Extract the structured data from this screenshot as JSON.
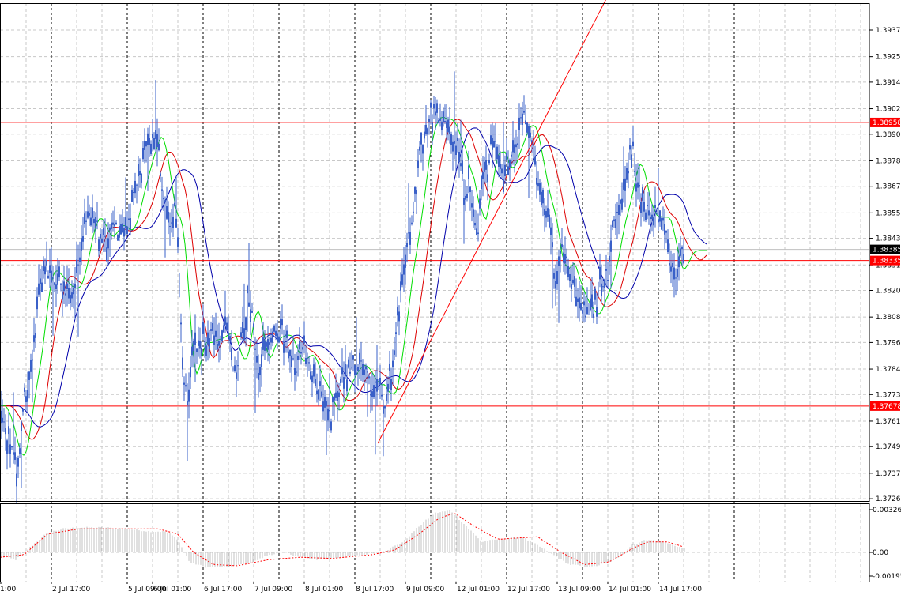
{
  "chart_data": [
    {
      "type": "candlestick",
      "grid": true,
      "price_axis_ticks": [
        "1.39375",
        "1.39255",
        "1.39140",
        "1.39020",
        "1.38905",
        "1.38785",
        "1.38670",
        "1.38550",
        "1.38435",
        "1.38315",
        "1.38200",
        "1.38080",
        "1.37965",
        "1.37845",
        "1.37730",
        "1.37610",
        "1.37495",
        "1.37375",
        "1.37260"
      ],
      "time_axis_labels": [
        "1:00",
        "2 Jul 17:00",
        "5 Jul 09:00",
        "6 Jul 01:00",
        "6 Jul 17:00",
        "7 Jul 09:00",
        "8 Jul 01:00",
        "8 Jul 17:00",
        "9 Jul 09:00",
        "12 Jul 01:00",
        "12 Jul 17:00",
        "13 Jul 09:00",
        "14 Jul 01:00",
        "14 Jul 17:00"
      ],
      "ylim": [
        1.3726,
        1.39505
      ],
      "horizontal_levels": [
        {
          "value": 1.38958,
          "label": "1.38958",
          "color": "#ff0000"
        },
        {
          "value": 1.38335,
          "label": "1.38335",
          "color": "#ff0000"
        },
        {
          "value": 1.37678,
          "label": "1.37678",
          "color": "#ff0000"
        }
      ],
      "current_price": {
        "value": 1.38385,
        "label": "1.38385"
      },
      "trendline": {
        "from_value": 1.3751,
        "to_value": 1.3955,
        "color": "#ff0000"
      },
      "series": [
        {
          "color": "#00dd00",
          "role": "fast-ma"
        },
        {
          "color": "#dd0000",
          "role": "medium-ma"
        },
        {
          "color": "#0000aa",
          "role": "slow-ma"
        }
      ],
      "close_path": [
        [
          0,
          1.3768
        ],
        [
          7,
          1.3756
        ],
        [
          14,
          1.3748
        ],
        [
          20,
          1.3738
        ],
        [
          26,
          1.3755
        ],
        [
          32,
          1.3775
        ],
        [
          38,
          1.3782
        ],
        [
          44,
          1.3796
        ],
        [
          50,
          1.3822
        ],
        [
          56,
          1.3832
        ],
        [
          62,
          1.3828
        ],
        [
          70,
          1.3826
        ],
        [
          78,
          1.3822
        ],
        [
          86,
          1.382
        ],
        [
          94,
          1.3822
        ],
        [
          102,
          1.3838
        ],
        [
          110,
          1.3852
        ],
        [
          118,
          1.3855
        ],
        [
          126,
          1.3845
        ],
        [
          134,
          1.3842
        ],
        [
          142,
          1.3852
        ],
        [
          150,
          1.3848
        ],
        [
          158,
          1.3845
        ],
        [
          166,
          1.3856
        ],
        [
          174,
          1.387
        ],
        [
          182,
          1.3878
        ],
        [
          188,
          1.3888
        ],
        [
          194,
          1.3892
        ],
        [
          198,
          1.389
        ],
        [
          204,
          1.387
        ],
        [
          210,
          1.3856
        ],
        [
          216,
          1.3848
        ],
        [
          222,
          1.3856
        ],
        [
          226,
          1.383
        ],
        [
          232,
          1.3778
        ],
        [
          238,
          1.3772
        ],
        [
          244,
          1.38
        ],
        [
          252,
          1.3795
        ],
        [
          262,
          1.3798
        ],
        [
          272,
          1.3798
        ],
        [
          282,
          1.3802
        ],
        [
          290,
          1.38
        ],
        [
          298,
          1.378
        ],
        [
          306,
          1.3798
        ],
        [
          314,
          1.3818
        ],
        [
          320,
          1.381
        ],
        [
          326,
          1.3782
        ],
        [
          332,
          1.379
        ],
        [
          340,
          1.38
        ],
        [
          348,
          1.3798
        ],
        [
          356,
          1.3802
        ],
        [
          362,
          1.3798
        ],
        [
          368,
          1.3788
        ],
        [
          376,
          1.3786
        ],
        [
          384,
          1.3795
        ],
        [
          392,
          1.3785
        ],
        [
          400,
          1.3778
        ],
        [
          408,
          1.3775
        ],
        [
          416,
          1.3762
        ],
        [
          424,
          1.3768
        ],
        [
          432,
          1.3778
        ],
        [
          440,
          1.3782
        ],
        [
          448,
          1.3788
        ],
        [
          456,
          1.3785
        ],
        [
          464,
          1.378
        ],
        [
          472,
          1.3775
        ],
        [
          480,
          1.378
        ],
        [
          486,
          1.3765
        ],
        [
          492,
          1.3778
        ],
        [
          498,
          1.379
        ],
        [
          504,
          1.381
        ],
        [
          510,
          1.3825
        ],
        [
          516,
          1.3842
        ],
        [
          522,
          1.385
        ],
        [
          528,
          1.3872
        ],
        [
          534,
          1.3888
        ],
        [
          540,
          1.3895
        ],
        [
          546,
          1.39
        ],
        [
          552,
          1.3898
        ],
        [
          558,
          1.3895
        ],
        [
          564,
          1.39
        ],
        [
          570,
          1.389
        ],
        [
          576,
          1.3882
        ],
        [
          582,
          1.3885
        ],
        [
          588,
          1.386
        ],
        [
          594,
          1.387
        ],
        [
          600,
          1.3845
        ],
        [
          606,
          1.3848
        ],
        [
          612,
          1.388
        ],
        [
          618,
          1.3875
        ],
        [
          624,
          1.389
        ],
        [
          630,
          1.388
        ],
        [
          636,
          1.387
        ],
        [
          642,
          1.3878
        ],
        [
          648,
          1.3885
        ],
        [
          656,
          1.389
        ],
        [
          662,
          1.39
        ],
        [
          668,
          1.3892
        ],
        [
          674,
          1.3885
        ],
        [
          680,
          1.3868
        ],
        [
          686,
          1.386
        ],
        [
          692,
          1.3855
        ],
        [
          698,
          1.3842
        ],
        [
          704,
          1.3818
        ],
        [
          710,
          1.3838
        ],
        [
          716,
          1.3832
        ],
        [
          722,
          1.3825
        ],
        [
          728,
          1.3818
        ],
        [
          734,
          1.3815
        ],
        [
          740,
          1.381
        ],
        [
          746,
          1.3808
        ],
        [
          752,
          1.381
        ],
        [
          758,
          1.3822
        ],
        [
          764,
          1.3822
        ],
        [
          770,
          1.383
        ],
        [
          776,
          1.3848
        ],
        [
          782,
          1.3855
        ],
        [
          788,
          1.386
        ],
        [
          794,
          1.3875
        ],
        [
          800,
          1.3885
        ],
        [
          806,
          1.3868
        ],
        [
          812,
          1.3858
        ],
        [
          818,
          1.3855
        ],
        [
          824,
          1.385
        ],
        [
          830,
          1.3856
        ],
        [
          836,
          1.3852
        ],
        [
          842,
          1.385
        ],
        [
          848,
          1.383
        ],
        [
          854,
          1.3825
        ],
        [
          860,
          1.3835
        ],
        [
          866,
          1.3838
        ]
      ],
      "macd_pane": {
        "ticks": [
          "0.003267",
          "0.00",
          "-0.00195"
        ],
        "ylim": [
          -0.00195,
          0.003267
        ],
        "histogram_color": "#c0c0c0",
        "signal_color": "#ff0000",
        "hist_path": [
          [
            0,
            -0.0003
          ],
          [
            20,
            -0.0006
          ],
          [
            40,
            0.0005
          ],
          [
            60,
            0.0015
          ],
          [
            80,
            0.0018
          ],
          [
            100,
            0.0019
          ],
          [
            130,
            0.0019
          ],
          [
            160,
            0.0018
          ],
          [
            190,
            0.0016
          ],
          [
            210,
            0.0016
          ],
          [
            225,
            0.001
          ],
          [
            240,
            -0.0008
          ],
          [
            260,
            -0.0012
          ],
          [
            290,
            -0.0012
          ],
          [
            320,
            -0.0008
          ],
          [
            340,
            -0.0002
          ],
          [
            360,
            0.0
          ],
          [
            380,
            -0.0004
          ],
          [
            400,
            -0.0006
          ],
          [
            430,
            -0.0004
          ],
          [
            460,
            -0.0002
          ],
          [
            490,
            0.0002
          ],
          [
            510,
            0.0008
          ],
          [
            530,
            0.002
          ],
          [
            550,
            0.003
          ],
          [
            570,
            0.0032
          ],
          [
            590,
            0.002
          ],
          [
            610,
            0.0008
          ],
          [
            630,
            0.001
          ],
          [
            660,
            0.0012
          ],
          [
            690,
            0.0002
          ],
          [
            720,
            -0.001
          ],
          [
            750,
            -0.0012
          ],
          [
            780,
            -0.0006
          ],
          [
            800,
            0.0006
          ],
          [
            820,
            0.001
          ],
          [
            840,
            0.0008
          ],
          [
            860,
            0.0004
          ],
          [
            866,
            0.0003
          ]
        ],
        "signal_path": [
          [
            0,
            -0.0004
          ],
          [
            30,
            -0.0002
          ],
          [
            60,
            0.0014
          ],
          [
            100,
            0.0018
          ],
          [
            150,
            0.0018
          ],
          [
            200,
            0.0018
          ],
          [
            225,
            0.0014
          ],
          [
            245,
            0.0
          ],
          [
            270,
            -0.001
          ],
          [
            300,
            -0.0011
          ],
          [
            340,
            -0.0006
          ],
          [
            380,
            -0.0004
          ],
          [
            420,
            -0.0005
          ],
          [
            470,
            -0.0002
          ],
          [
            500,
            0.0002
          ],
          [
            530,
            0.0014
          ],
          [
            555,
            0.0026
          ],
          [
            575,
            0.003
          ],
          [
            600,
            0.002
          ],
          [
            630,
            0.001
          ],
          [
            680,
            0.0012
          ],
          [
            710,
            0.0
          ],
          [
            740,
            -0.001
          ],
          [
            770,
            -0.0008
          ],
          [
            800,
            0.0003
          ],
          [
            820,
            0.0008
          ],
          [
            845,
            0.0008
          ],
          [
            866,
            0.0004
          ]
        ]
      }
    }
  ]
}
